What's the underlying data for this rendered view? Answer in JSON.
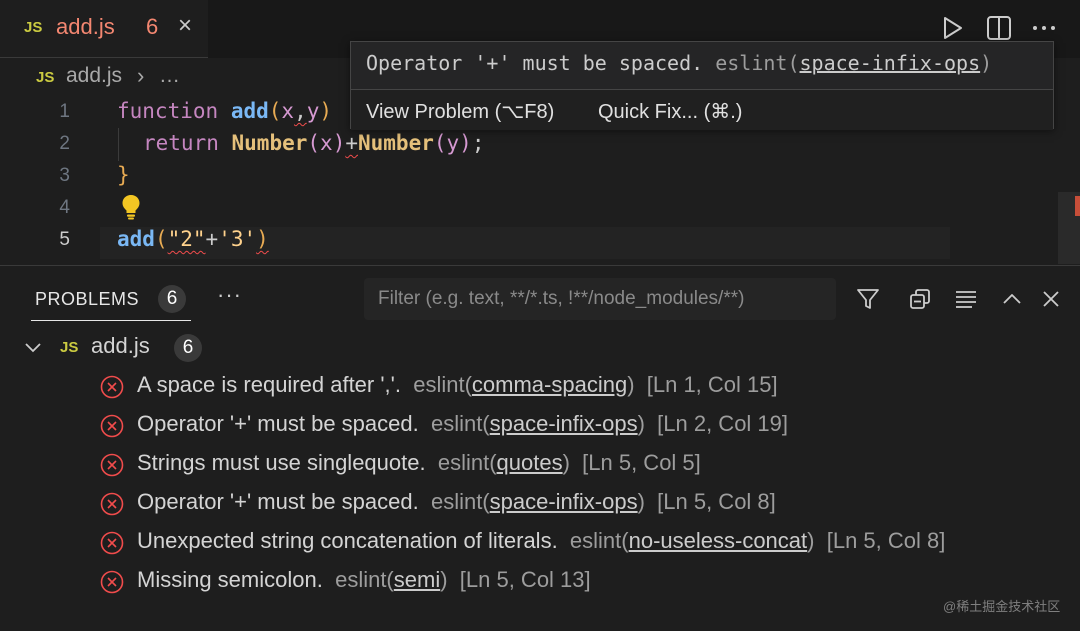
{
  "tab": {
    "js_icon": "JS",
    "filename": "add.js",
    "problem_count": "6",
    "close": "×"
  },
  "breadcrumb": {
    "js_icon": "JS",
    "file": "add.js",
    "separator": "›",
    "more": "…"
  },
  "editor": {
    "line_numbers": [
      "1",
      "2",
      "3",
      "4",
      "5"
    ],
    "active_line": 5,
    "code": {
      "l1_kw": "function",
      "l1_fn": "add",
      "l1_open": "(",
      "l1_x": "x",
      "l1_comma": ",",
      "l1_y": "y",
      "l1_close": ")",
      "l2_kw": "return",
      "l2_fn1": "Number",
      "l2_p1": "(",
      "l2_x": "x",
      "l2_p2": ")",
      "l2_plus": "+",
      "l2_fn2": "Number",
      "l2_p3": "(",
      "l2_y": "y",
      "l2_p4": ")",
      "l2_semi": ";",
      "l3": "}",
      "l5_fn": "add",
      "l5_open": "(",
      "l5_s1": "\"2\"",
      "l5_plus": "+",
      "l5_s2": "'3'",
      "l5_close": ")"
    },
    "lightbulb_icon": "lightbulb-icon"
  },
  "hover": {
    "message": "Operator '+' must be spaced. ",
    "source": "eslint(",
    "rule": "space-infix-ops",
    "source_close": ")",
    "view_problem": "View Problem (⌥F8)",
    "quick_fix": "Quick Fix... (⌘.)"
  },
  "panel": {
    "tab_label": "PROBLEMS",
    "tab_count": "6",
    "more": "···",
    "filter_placeholder": "Filter (e.g. text, **/*.ts, !**/node_modules/**)",
    "group": {
      "js_icon": "JS",
      "file": "add.js",
      "count": "6"
    },
    "problems": [
      {
        "message": "A space is required after ','.",
        "source": "eslint(",
        "rule": "comma-spacing",
        "close": ")",
        "location": "[Ln 1, Col 15]"
      },
      {
        "message": "Operator '+' must be spaced.",
        "source": "eslint(",
        "rule": "space-infix-ops",
        "close": ")",
        "location": "[Ln 2, Col 19]"
      },
      {
        "message": "Strings must use singlequote.",
        "source": "eslint(",
        "rule": "quotes",
        "close": ")",
        "location": "[Ln 5, Col 5]"
      },
      {
        "message": "Operator '+' must be spaced.",
        "source": "eslint(",
        "rule": "space-infix-ops",
        "close": ")",
        "location": "[Ln 5, Col 8]"
      },
      {
        "message": "Unexpected string concatenation of literals.",
        "source": "eslint(",
        "rule": "no-useless-concat",
        "close": ")",
        "location": "[Ln 5, Col 8]"
      },
      {
        "message": "Missing semicolon.",
        "source": "eslint(",
        "rule": "semi",
        "close": ")",
        "location": "[Ln 5, Col 13]"
      }
    ]
  },
  "watermark": "@稀土掘金技术社区",
  "colors": {
    "error": "#f14c4c",
    "js_icon": "#cbcb41",
    "tab_title": "#f48771",
    "keyword": "#c586c0",
    "function": "#7ab8f5"
  }
}
